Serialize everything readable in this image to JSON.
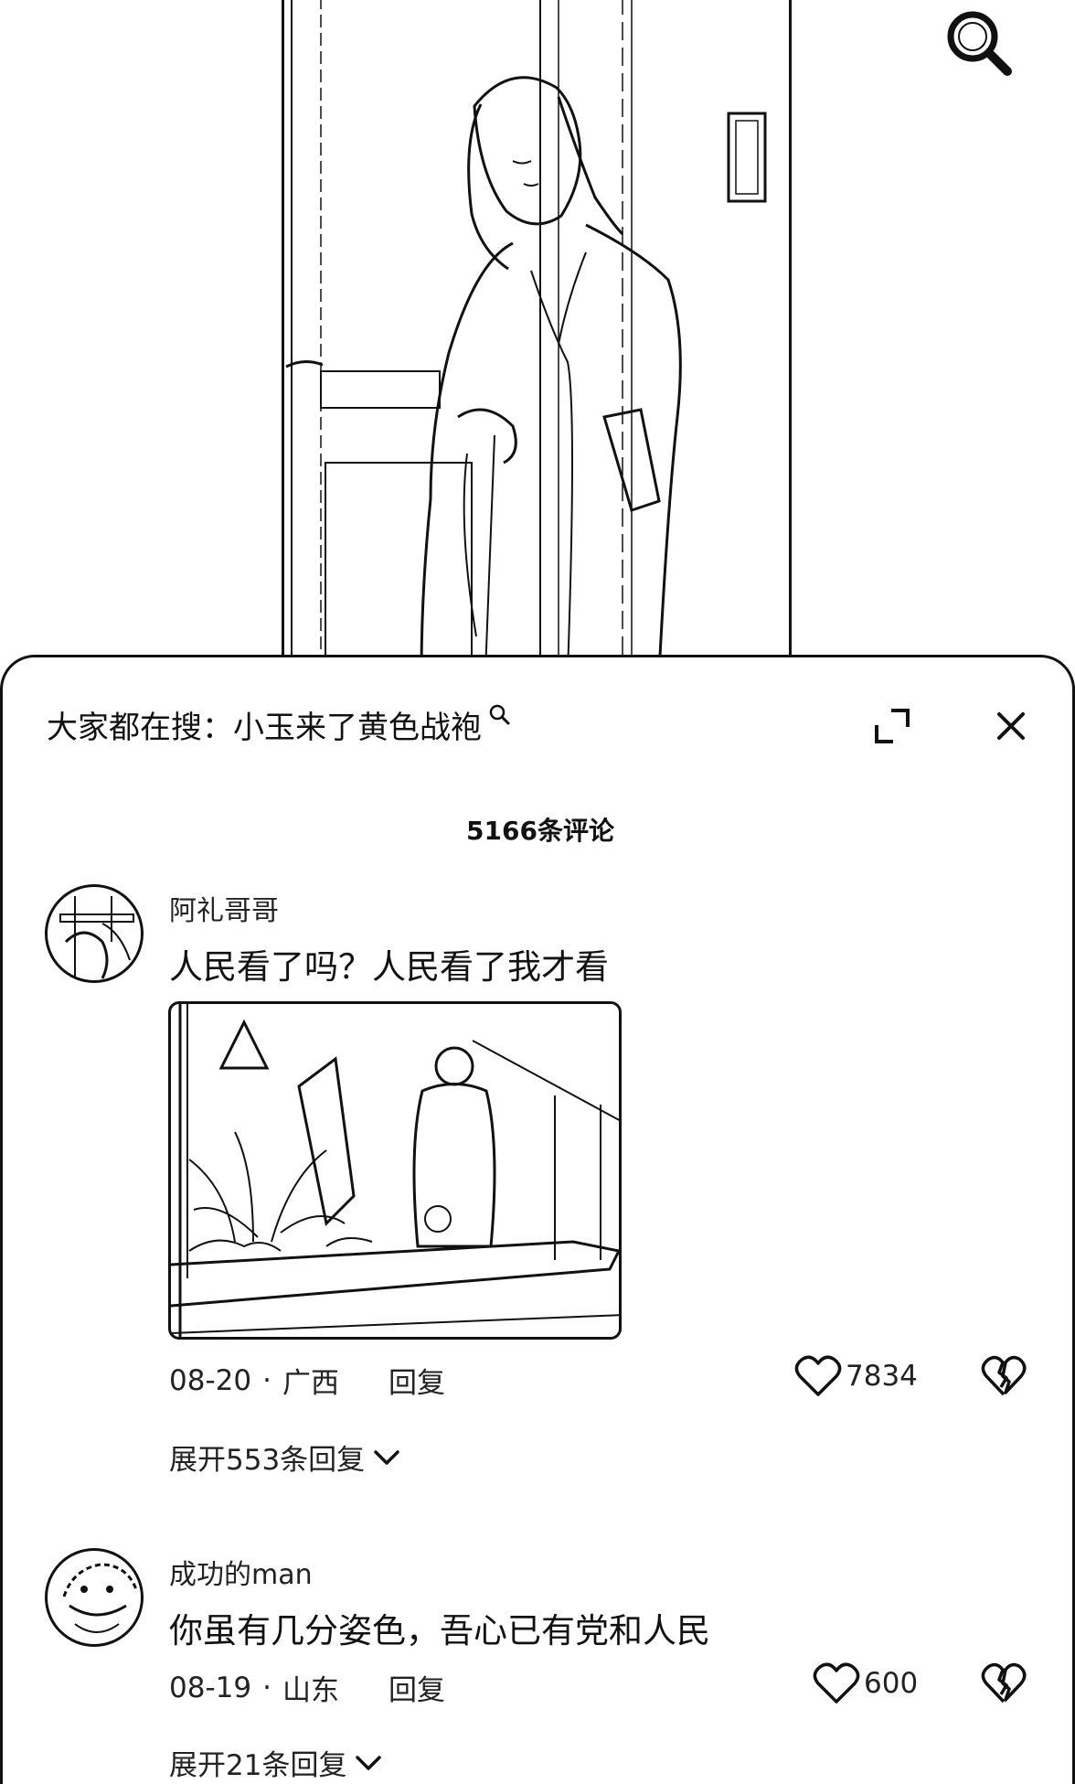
{
  "search_bar": {
    "prefix": "大家都在搜：",
    "query": "小玉来了黄色战袍"
  },
  "comments_count": "5166条评论",
  "comments": [
    {
      "username": "阿礼哥哥",
      "text": "人民看了吗？人民看了我才看",
      "date": "08-20",
      "location": "广西",
      "reply_label": "回复",
      "likes": "7834",
      "expand_label": "展开553条回复"
    },
    {
      "username": "成功的man",
      "text": "你虽有几分姿色，吾心已有党和人民",
      "date": "08-19",
      "location": "山东",
      "reply_label": "回复",
      "likes": "600",
      "expand_label": "展开21条回复"
    }
  ],
  "separator": "·",
  "colors": {
    "ink": "#111111",
    "background": "#ffffff"
  }
}
